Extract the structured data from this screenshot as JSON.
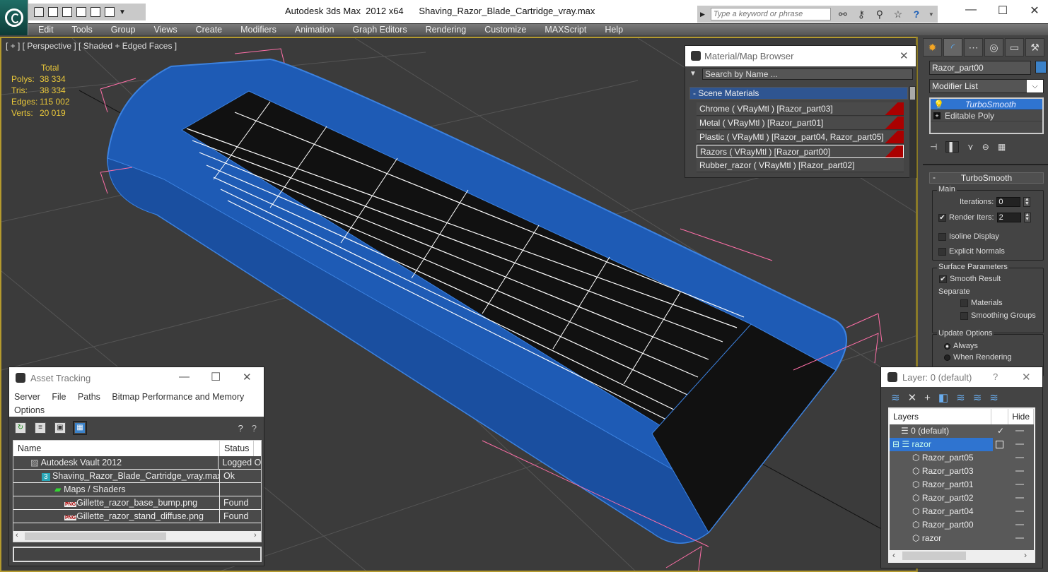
{
  "app": {
    "title": "Autodesk 3ds Max  2012 x64",
    "filename": "Shaving_Razor_Blade_Cartridge_vray.max",
    "search_placeholder": "Type a keyword or phrase",
    "window_controls": {
      "minimize": "—",
      "maximize": "☐",
      "close": "✕"
    }
  },
  "quick_access": [
    "open-icon",
    "save-icon",
    "new-icon",
    "project-icon",
    "undo-icon",
    "redo-icon",
    "dropdown-icon"
  ],
  "menu": [
    "Edit",
    "Tools",
    "Group",
    "Views",
    "Create",
    "Modifiers",
    "Animation",
    "Graph Editors",
    "Rendering",
    "Customize",
    "MAXScript",
    "Help"
  ],
  "viewport": {
    "label": "[ + ] [ Perspective ] [ Shaded + Edged Faces ]",
    "stats": {
      "header": "Total",
      "rows": [
        {
          "label": "Polys:",
          "value": "38 334"
        },
        {
          "label": "Tris:",
          "value": "38 334"
        },
        {
          "label": "Edges:",
          "value": "115 002"
        },
        {
          "label": "Verts:",
          "value": "20 019"
        }
      ]
    },
    "colors": {
      "model": "#1e5bb5",
      "wire": "#3c82e0",
      "selection_box": "#ff6fa8",
      "background": "#3b3b3b"
    }
  },
  "command_panel": {
    "tabs": [
      "create-icon",
      "modify-icon",
      "hierarchy-icon",
      "motion-icon",
      "display-icon",
      "utilities-icon"
    ],
    "object_name": "Razor_part00",
    "object_color": "#3c82c8",
    "modifier_list": "Modifier List",
    "stack": [
      {
        "label": "TurboSmooth",
        "selected": true
      },
      {
        "label": "Editable Poly",
        "selected": false
      }
    ],
    "rollout": {
      "title": "TurboSmooth",
      "main_label": "Main",
      "iterations_label": "Iterations:",
      "iterations_value": "0",
      "render_iters_label": "Render Iters:",
      "render_iters_value": "2",
      "render_iters_checked": true,
      "isoline_label": "Isoline Display",
      "explicit_normals_label": "Explicit Normals",
      "surface_label": "Surface Parameters",
      "smooth_result_label": "Smooth Result",
      "separate_label": "Separate",
      "materials_label": "Materials",
      "smoothing_groups_label": "Smoothing Groups",
      "update_label": "Update Options",
      "always_label": "Always",
      "when_rendering_label": "When Rendering"
    }
  },
  "material_browser": {
    "title": "Material/Map Browser",
    "search_placeholder": "Search by Name ...",
    "section": "- Scene Materials",
    "materials": [
      {
        "label": "Chrome  ( VRayMtl ) [Razor_part03]",
        "selected": false
      },
      {
        "label": "Metal  ( VRayMtl ) [Razor_part01]",
        "selected": false
      },
      {
        "label": "Plastic  ( VRayMtl ) [Razor_part04, Razor_part05]",
        "selected": false
      },
      {
        "label": "Razors  ( VRayMtl ) [Razor_part00]",
        "selected": true
      },
      {
        "label": "Rubber_razor  ( VRayMtl ) [Razor_part02]",
        "selected": false
      }
    ]
  },
  "asset_tracking": {
    "title": "Asset Tracking",
    "menu": [
      "Server",
      "File",
      "Paths",
      "Bitmap Performance and Memory",
      "Options"
    ],
    "columns": [
      "Name",
      "Status"
    ],
    "rows": [
      {
        "name": "Autodesk Vault 2012",
        "status": "Logged O",
        "indent": 1,
        "icon": "vault-icon"
      },
      {
        "name": "Shaving_Razor_Blade_Cartridge_vray.max",
        "status": "Ok",
        "indent": 2,
        "icon": "max-file-icon"
      },
      {
        "name": "Maps / Shaders",
        "status": "",
        "indent": 3,
        "icon": "maps-icon"
      },
      {
        "name": "Gillette_razor_base_bump.png",
        "status": "Found",
        "indent": 4,
        "icon": "png-icon"
      },
      {
        "name": "Gillette_razor_stand_diffuse.png",
        "status": "Found",
        "indent": 4,
        "icon": "png-icon"
      }
    ]
  },
  "layers": {
    "title": "Layer: 0 (default)",
    "help": "?",
    "columns": [
      "Layers",
      "",
      "Hide"
    ],
    "rows": [
      {
        "name": "0 (default)",
        "indent": 1,
        "type": "layer",
        "current": true
      },
      {
        "name": "razor",
        "indent": 0,
        "type": "layer",
        "selected": true,
        "expanded": true
      },
      {
        "name": "Razor_part05",
        "indent": 2,
        "type": "object"
      },
      {
        "name": "Razor_part03",
        "indent": 2,
        "type": "object"
      },
      {
        "name": "Razor_part01",
        "indent": 2,
        "type": "object"
      },
      {
        "name": "Razor_part02",
        "indent": 2,
        "type": "object"
      },
      {
        "name": "Razor_part04",
        "indent": 2,
        "type": "object"
      },
      {
        "name": "Razor_part00",
        "indent": 2,
        "type": "object"
      },
      {
        "name": "razor",
        "indent": 2,
        "type": "object"
      }
    ]
  }
}
